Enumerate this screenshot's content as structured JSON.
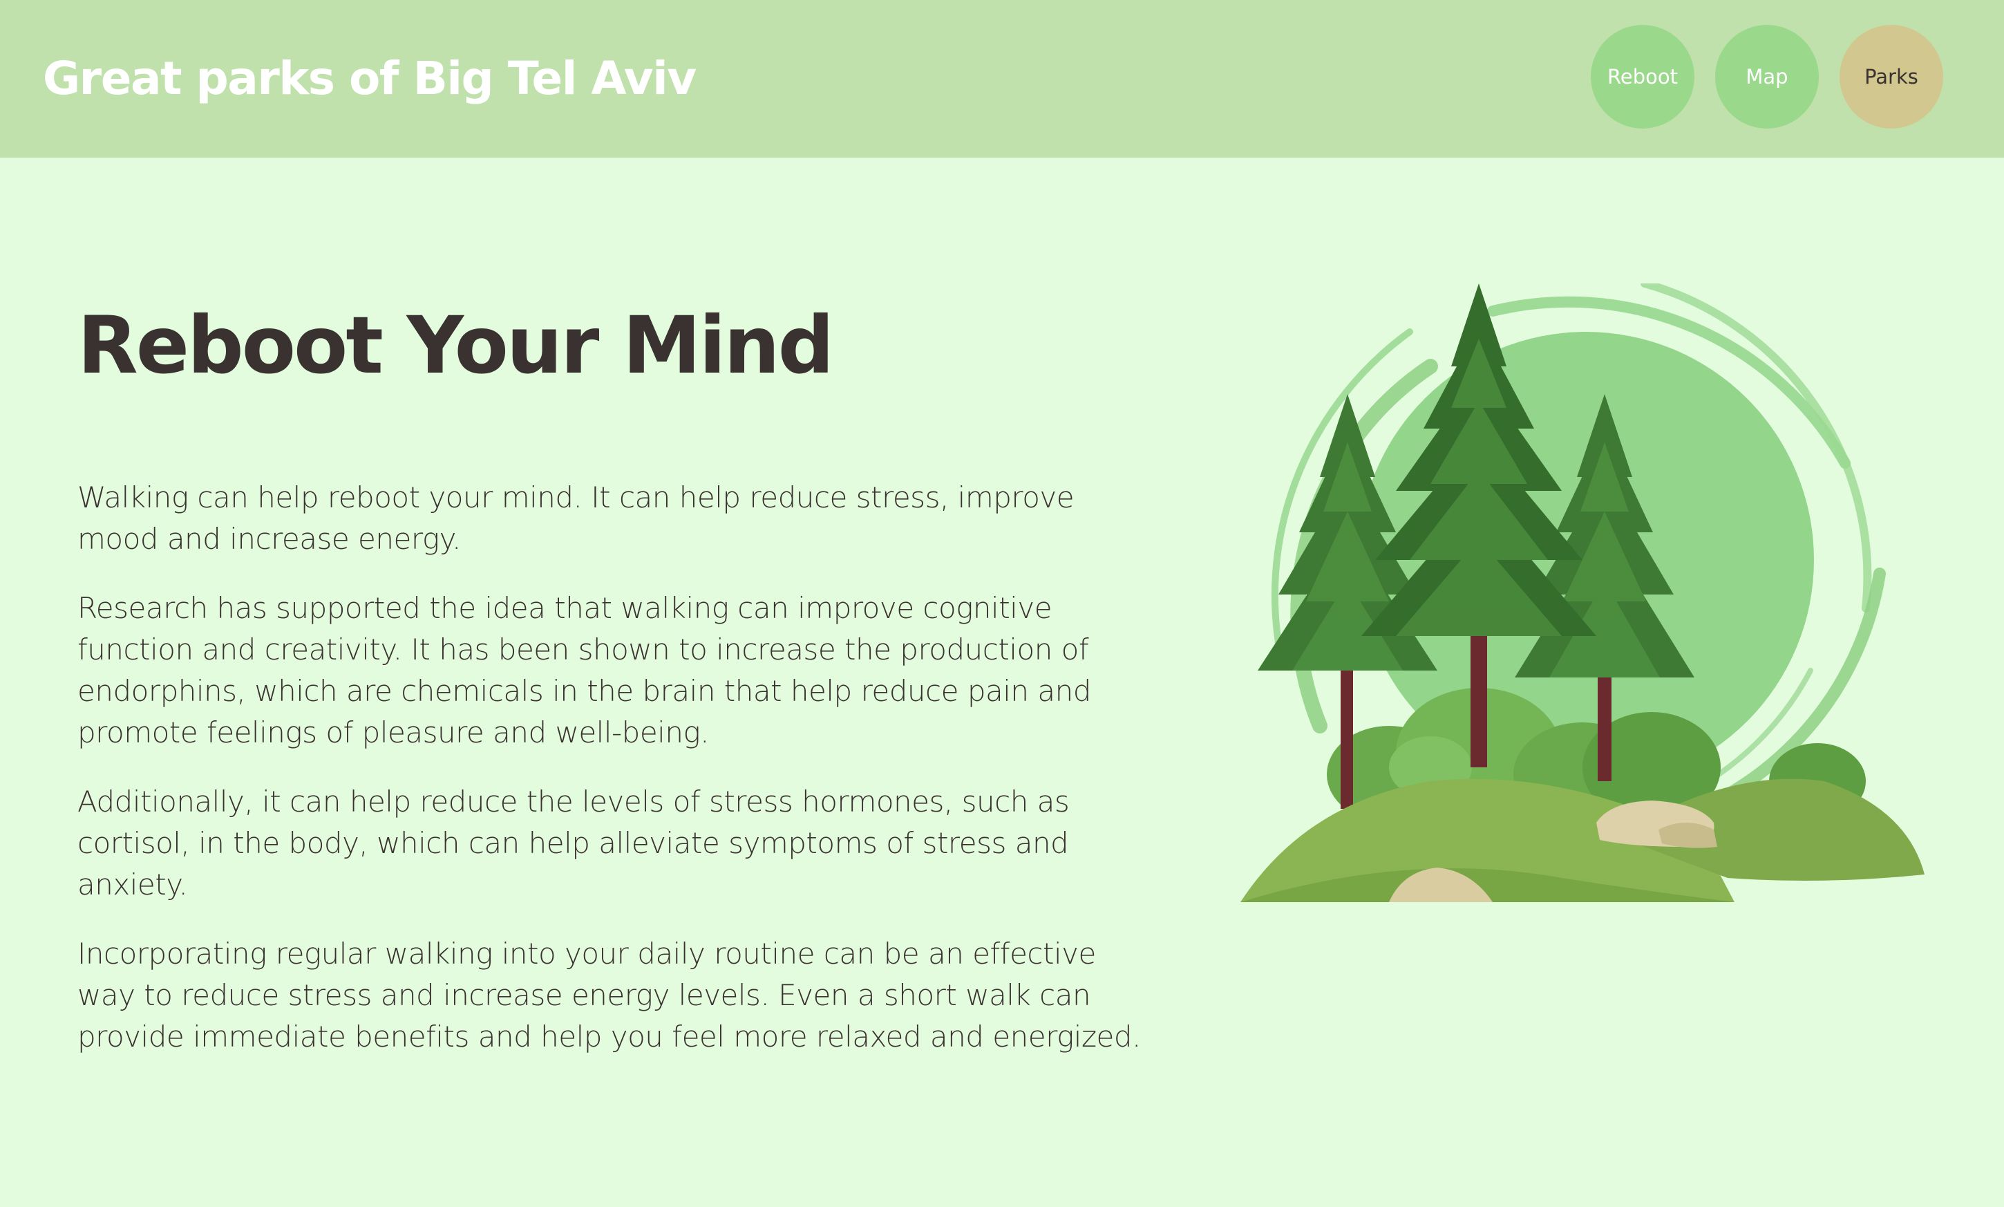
{
  "site": {
    "title": "Great parks of Big Tel Aviv"
  },
  "nav": {
    "items": [
      {
        "label": "Reboot"
      },
      {
        "label": "Map"
      },
      {
        "label": "Parks"
      }
    ],
    "active": "Parks"
  },
  "main": {
    "title": "Reboot Your Mind",
    "paragraphs": [
      "Walking can help reboot your mind. It can help reduce stress, improve mood and increase energy.",
      "Research has supported the idea that walking can improve cognitive function and creativity. It has been shown to increase the production of endorphins, which are chemicals in the brain that help reduce pain and promote feelings of pleasure and well-being.",
      "Additionally, it can help reduce the levels of stress hormones, such as cortisol, in the body, which can help alleviate symptoms of stress and anxiety.",
      "Incorporating regular walking into your daily routine can be an effective way to reduce stress and increase energy levels. Even a short walk can provide immediate benefits and help you feel more relaxed and energized."
    ]
  },
  "colors": {
    "page_background": "#e3fcdd",
    "header_background": "#c0e1ab",
    "nav_button": "#9ad88b",
    "nav_button_active": "#d2c78e",
    "text": "#3a3230"
  },
  "illustration": {
    "icon": "pine-trees-illustration"
  }
}
